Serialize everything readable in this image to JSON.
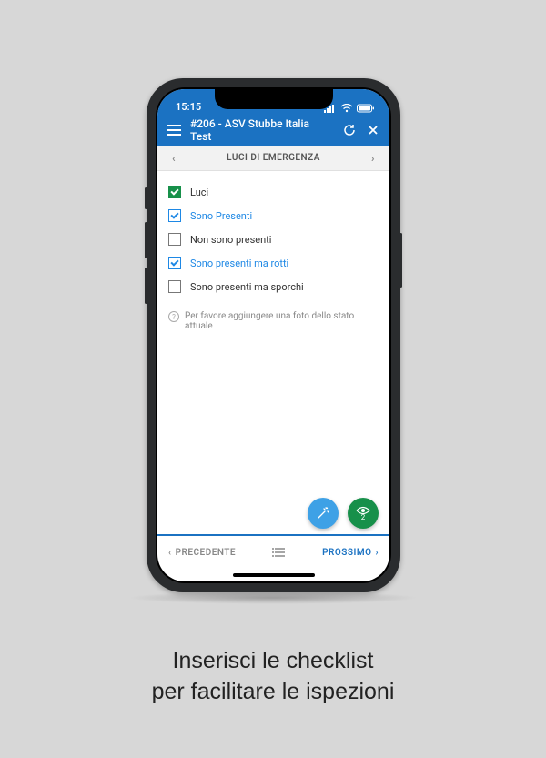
{
  "status_bar": {
    "time": "15:15"
  },
  "header": {
    "title": "#206 - ASV Stubbe Italia Test"
  },
  "section": {
    "title": "LUCI DI EMERGENZA"
  },
  "items": [
    {
      "label": "Luci"
    },
    {
      "label": "Sono Presenti"
    },
    {
      "label": "Non sono presenti"
    },
    {
      "label": "Sono presenti ma rotti"
    },
    {
      "label": "Sono presenti ma sporchi"
    }
  ],
  "hint": {
    "text": "Per favore aggiungere una foto dello stato attuale"
  },
  "fab": {
    "view_count": "2"
  },
  "bottom": {
    "prev": "PRECEDENTE",
    "next": "PROSSIMO"
  },
  "caption": {
    "line1": "Inserisci le checklist",
    "line2": "per facilitare le ispezioni"
  }
}
